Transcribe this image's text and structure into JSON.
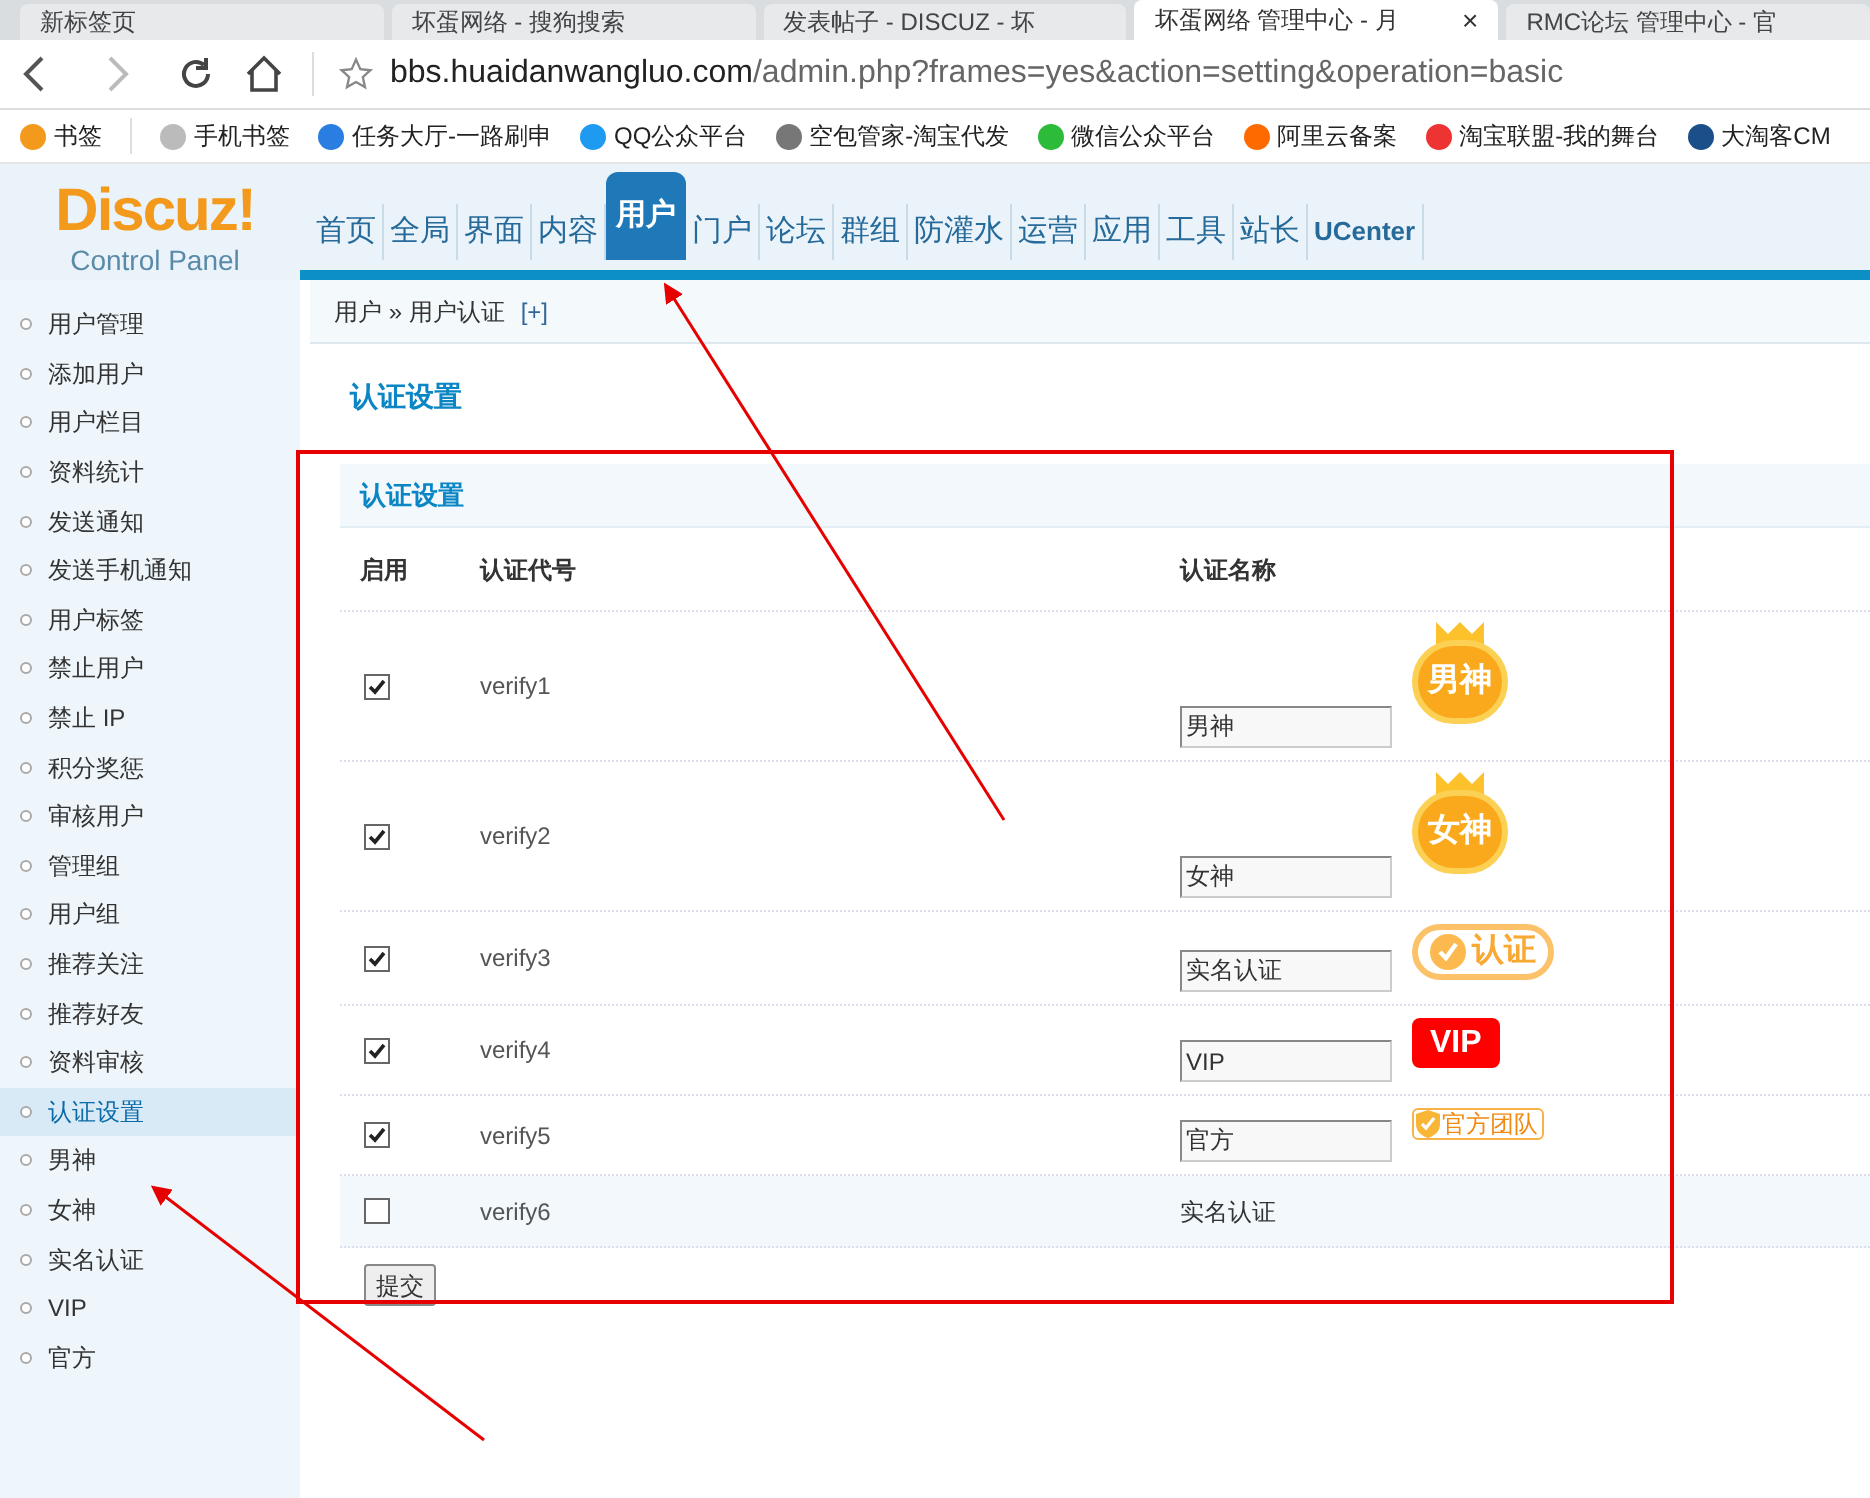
{
  "browser": {
    "tabs": [
      {
        "title": "新标签页",
        "selected": false
      },
      {
        "title": "坏蛋网络 - 搜狗搜索",
        "selected": false
      },
      {
        "title": "发表帖子 - DISCUZ - 坏",
        "selected": false
      },
      {
        "title": "坏蛋网络 管理中心 - 月",
        "selected": true,
        "close": "×"
      },
      {
        "title": "RMC论坛 管理中心 - 官",
        "selected": false
      }
    ],
    "url_host": "bbs.huaidanwangluo.com",
    "url_path": "/admin.php?frames=yes&action=setting&operation=basic",
    "bookmarks": [
      "书签",
      "手机书签",
      "任务大厅-一路刷申",
      "QQ公众平台",
      "空包管家-淘宝代发",
      "微信公众平台",
      "阿里云备案",
      "淘宝联盟-我的舞台",
      "大淘客CM"
    ]
  },
  "header": {
    "logo": "Discuz!",
    "logo_sub": "Control Panel",
    "nav": [
      {
        "label": "首页",
        "selected": false
      },
      {
        "label": "全局",
        "selected": false
      },
      {
        "label": "界面",
        "selected": false
      },
      {
        "label": "内容",
        "selected": false
      },
      {
        "label": "用户",
        "selected": true
      },
      {
        "label": "门户",
        "selected": false
      },
      {
        "label": "论坛",
        "selected": false
      },
      {
        "label": "群组",
        "selected": false
      },
      {
        "label": "防灌水",
        "selected": false
      },
      {
        "label": "运营",
        "selected": false
      },
      {
        "label": "应用",
        "selected": false
      },
      {
        "label": "工具",
        "selected": false
      },
      {
        "label": "站长",
        "selected": false
      },
      {
        "label": "UCenter",
        "selected": false
      }
    ],
    "breadcrumb": "用户 » 用户认证",
    "breadcrumb_add": "[+]"
  },
  "sidebar": {
    "items": [
      {
        "label": "用户管理",
        "selected": false
      },
      {
        "label": "添加用户",
        "selected": false
      },
      {
        "label": "用户栏目",
        "selected": false
      },
      {
        "label": "资料统计",
        "selected": false
      },
      {
        "label": "发送通知",
        "selected": false
      },
      {
        "label": "发送手机通知",
        "selected": false
      },
      {
        "label": "用户标签",
        "selected": false
      },
      {
        "label": "禁止用户",
        "selected": false
      },
      {
        "label": "禁止 IP",
        "selected": false
      },
      {
        "label": "积分奖惩",
        "selected": false
      },
      {
        "label": "审核用户",
        "selected": false
      },
      {
        "label": "管理组",
        "selected": false
      },
      {
        "label": "用户组",
        "selected": false
      },
      {
        "label": "推荐关注",
        "selected": false
      },
      {
        "label": "推荐好友",
        "selected": false
      },
      {
        "label": "资料审核",
        "selected": false
      },
      {
        "label": "认证设置",
        "selected": true
      },
      {
        "label": "男神",
        "selected": false
      },
      {
        "label": "女神",
        "selected": false
      },
      {
        "label": "实名认证",
        "selected": false
      },
      {
        "label": "VIP",
        "selected": false
      },
      {
        "label": "官方",
        "selected": false
      }
    ]
  },
  "main": {
    "title": "认证设置",
    "table": {
      "title": "认证设置",
      "columns": [
        "启用",
        "认证代号",
        "认证名称"
      ],
      "rows": [
        {
          "checked": true,
          "code": "verify1",
          "kind": "field",
          "name": "男神",
          "badge": {
            "kind": "crown",
            "text": "男神"
          }
        },
        {
          "checked": true,
          "code": "verify2",
          "kind": "field",
          "name": "女神",
          "badge": {
            "kind": "crown",
            "text": "女神"
          }
        },
        {
          "checked": true,
          "code": "verify3",
          "kind": "field",
          "name": "实名认证",
          "badge": {
            "kind": "check",
            "text": "认证"
          }
        },
        {
          "checked": true,
          "code": "verify4",
          "kind": "field",
          "name": "VIP",
          "badge": {
            "kind": "vip",
            "text": "VIP"
          }
        },
        {
          "checked": true,
          "code": "verify5",
          "kind": "field",
          "name": "官方",
          "badge": {
            "kind": "team",
            "text": "官方团队"
          }
        },
        {
          "checked": false,
          "code": "verify6",
          "kind": "text",
          "name": "实名认证"
        }
      ]
    },
    "submit": "提交"
  }
}
